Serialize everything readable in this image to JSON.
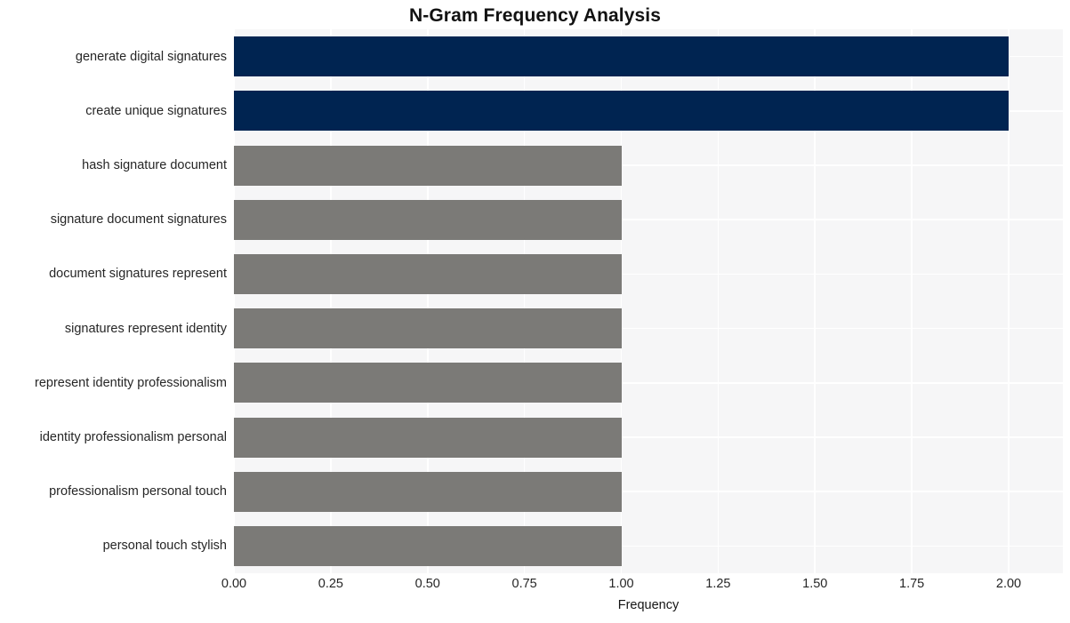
{
  "chart_data": {
    "type": "bar",
    "orientation": "horizontal",
    "title": "N-Gram Frequency Analysis",
    "xlabel": "Frequency",
    "ylabel": "",
    "categories": [
      "generate digital signatures",
      "create unique signatures",
      "hash signature document",
      "signature document signatures",
      "document signatures represent",
      "signatures represent identity",
      "represent identity professionalism",
      "identity professionalism personal",
      "professionalism personal touch",
      "personal touch stylish"
    ],
    "values": [
      2,
      2,
      1,
      1,
      1,
      1,
      1,
      1,
      1,
      1
    ],
    "bar_colors": [
      "#002451",
      "#002451",
      "#7b7a77",
      "#7b7a77",
      "#7b7a77",
      "#7b7a77",
      "#7b7a77",
      "#7b7a77",
      "#7b7a77",
      "#7b7a77"
    ],
    "xlim": [
      0,
      2.14
    ],
    "xticks": [
      0,
      0.25,
      0.5,
      0.75,
      1,
      1.25,
      1.5,
      1.75,
      2
    ],
    "xtick_labels": [
      "0.00",
      "0.25",
      "0.50",
      "0.75",
      "1.00",
      "1.25",
      "1.50",
      "1.75",
      "2.00"
    ],
    "grid": true,
    "grid_color": "#ffffff",
    "plot_background": "#f6f6f7",
    "figure_background": "#ffffff",
    "legend": null,
    "accent_color": "#002451",
    "secondary_color": "#7b7a77"
  }
}
